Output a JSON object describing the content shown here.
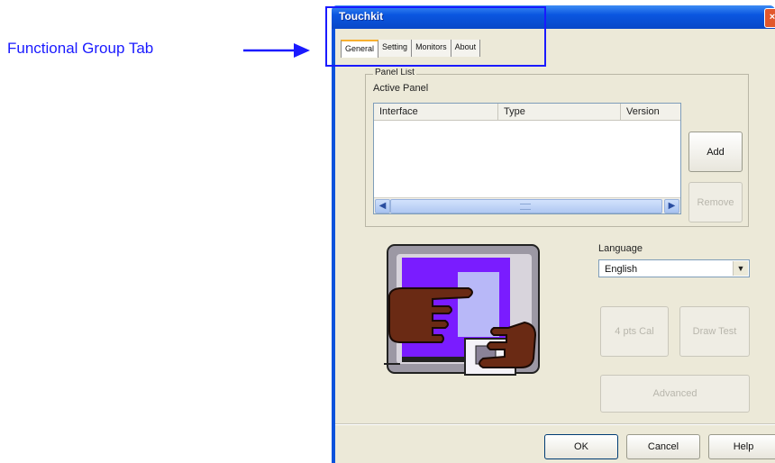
{
  "annotation": {
    "label": "Functional Group Tab",
    "color": "#1a1aff"
  },
  "window": {
    "title": "Touchkit",
    "close_glyph": "×"
  },
  "tabs": [
    {
      "label": "General",
      "active": true
    },
    {
      "label": "Setting",
      "active": false
    },
    {
      "label": "Monitors",
      "active": false
    },
    {
      "label": "About",
      "active": false
    }
  ],
  "panel_list": {
    "group_title": "Panel List",
    "active_panel_label": "Active Panel",
    "columns": [
      "Interface",
      "Type",
      "Version"
    ],
    "rows": []
  },
  "buttons": {
    "add": "Add",
    "remove": "Remove",
    "four_pts_cal": "4 pts Cal",
    "draw_test": "Draw Test",
    "advanced": "Advanced",
    "ok": "OK",
    "cancel": "Cancel",
    "help": "Help"
  },
  "language": {
    "label": "Language",
    "selected": "English"
  },
  "icons": {
    "scroll_left": "◀",
    "scroll_right": "▶",
    "dropdown": "▼"
  },
  "colors": {
    "titlebar": "#0a56e0",
    "dialog_bg": "#ece9d8"
  }
}
